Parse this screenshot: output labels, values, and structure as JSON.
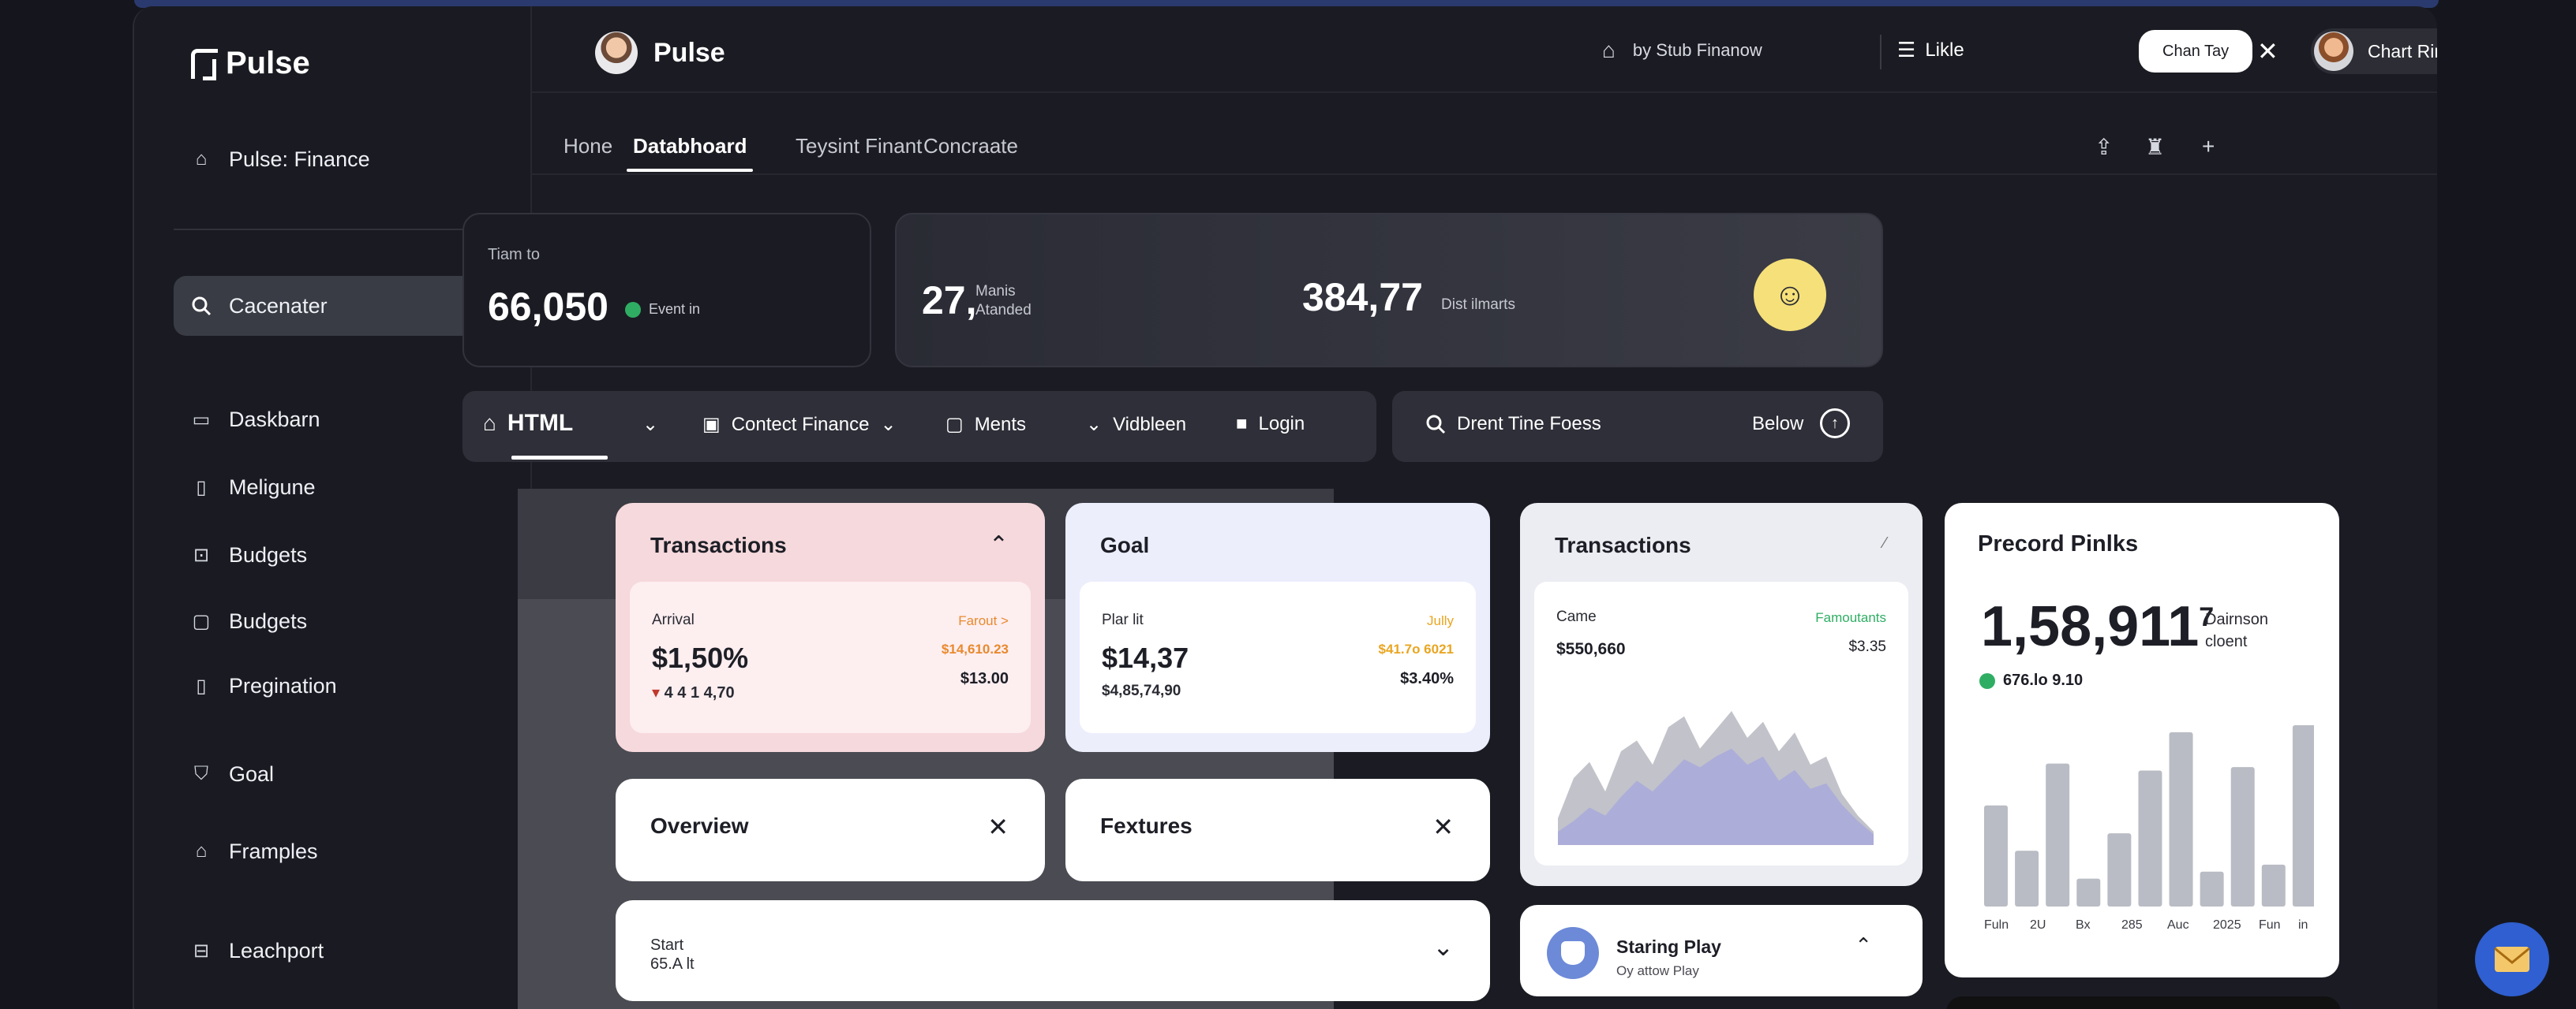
{
  "app": {
    "logo_text": "Pulse",
    "header_title": "Pulse"
  },
  "sidebar": {
    "items": [
      {
        "label": "Pulse: Finance",
        "icon": "home-icon"
      },
      {
        "label": "Cacenater",
        "icon": "search-icon"
      },
      {
        "label": "Daskbarn",
        "icon": "dashboard-icon"
      },
      {
        "label": "Meligune",
        "icon": "document-icon"
      },
      {
        "label": "Budgets",
        "icon": "lock-icon"
      },
      {
        "label": "Budgets",
        "icon": "chat-icon"
      },
      {
        "label": "Pregination",
        "icon": "clipboard-icon"
      },
      {
        "label": "Goal",
        "icon": "shield-icon"
      },
      {
        "label": "Framples",
        "icon": "building-icon"
      },
      {
        "label": "Leachport",
        "icon": "bank-icon"
      }
    ]
  },
  "header": {
    "search_text": "by Stub Finanow",
    "menu_label": "Likle",
    "button_label": "Chan Tay",
    "user_name": "Chart Ring"
  },
  "tabs": [
    {
      "label": "Hone"
    },
    {
      "label": "Databhoard"
    },
    {
      "label": "Teysint Finant"
    },
    {
      "label": "Concraate"
    }
  ],
  "stats": {
    "card1": {
      "label": "Tiam to",
      "value": "66,050",
      "tag": "Event in"
    },
    "card2": {
      "value1": "27,",
      "sub1_line1": "Manis",
      "sub1_line2": "Atanded",
      "value2": "384,77",
      "sub2": "Dist ilmarts"
    }
  },
  "filterbar": {
    "main": "HTML",
    "contect": "Contect Finance",
    "ments": "Ments",
    "vidbleen": "Vidbleen",
    "login": "Login"
  },
  "search": {
    "query": "Drent Tine Foess",
    "below": "Below"
  },
  "cards": {
    "transactions1": {
      "title": "Transactions",
      "label": "Arrival",
      "value": "$1,50%",
      "sub": "4 4 1 4,70",
      "r1": "Farout >",
      "r2": "$14,610.23",
      "r3": "$13.00"
    },
    "goal": {
      "title": "Goal",
      "label": "Plar lit",
      "value": "$14,37",
      "sub": "$4,85,74,90",
      "r1": "Jully",
      "r2": "$41.7o 6021",
      "r3": "$3.40%"
    },
    "transactions2": {
      "title": "Transactions",
      "label": "Came",
      "value": "$550,660",
      "r1": "Famoutants",
      "r2": "$3.35"
    },
    "overview": {
      "title": "Overview"
    },
    "fextures": {
      "title": "Fextures"
    },
    "start": {
      "label": "Start",
      "value": "65.A lt"
    },
    "staring": {
      "title": "Staring Play",
      "sub": "Oy attow Play"
    }
  },
  "precord": {
    "title": "Precord Pinlks",
    "value": "1,58,911",
    "superscript": "7",
    "side_line1": "Dairnson",
    "side_line2": "cloent",
    "delta": "676.lo 9.10"
  },
  "chart_data": [
    {
      "type": "bar",
      "categories": [
        "Fuln",
        "2U",
        "Bx",
        "285",
        "Auc",
        "2025",
        "Fun",
        "in"
      ],
      "series": [
        {
          "values": [
            58,
            32,
            82,
            16,
            42,
            78,
            100,
            20,
            80,
            24,
            104
          ]
        }
      ],
      "tick_labels": [
        "Fuln",
        "2U",
        "Bx",
        "285",
        "Auc",
        "2025",
        "Fun",
        "in"
      ],
      "color": "#b9bcc4"
    },
    {
      "type": "area",
      "x": [
        0,
        1,
        2,
        3,
        4,
        5,
        6,
        7,
        8,
        9,
        10,
        11,
        12,
        13,
        14,
        15,
        16,
        17,
        18,
        19,
        20
      ],
      "series": [
        {
          "values": [
            20,
            50,
            62,
            40,
            70,
            78,
            60,
            88,
            96,
            72,
            86,
            100,
            80,
            92,
            70,
            84,
            60,
            66,
            38,
            22,
            10
          ],
          "color": "#b7b9c1"
        },
        {
          "values": [
            10,
            18,
            28,
            22,
            36,
            48,
            40,
            52,
            64,
            58,
            66,
            72,
            60,
            66,
            48,
            56,
            42,
            46,
            30,
            18,
            8
          ],
          "color": "#a7a8dc"
        }
      ]
    }
  ],
  "colors": {
    "bg": "#15161d",
    "panel": "#1b1c23",
    "accent_yellow": "#f5e07a",
    "card_pink": "#f7dadd",
    "card_lavender": "#eceefc",
    "orange": "#e88a2e",
    "amber": "#e9a521",
    "green": "#2fae63",
    "fab_blue": "#2f5fd0"
  }
}
